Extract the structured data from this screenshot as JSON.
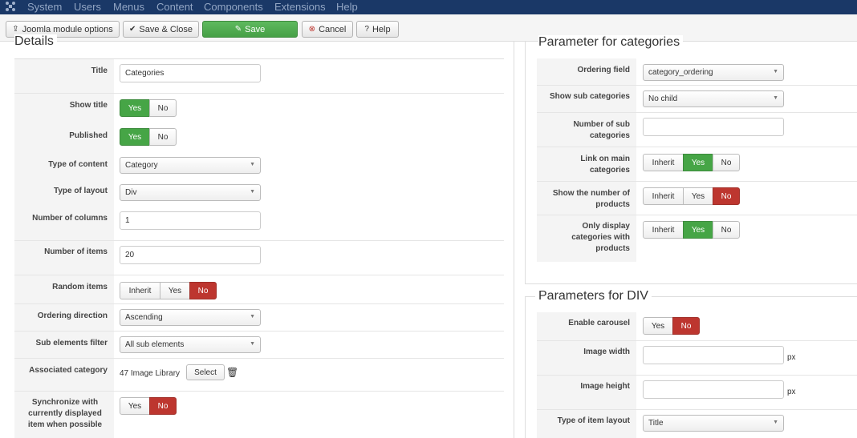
{
  "navbar": {
    "items": [
      "System",
      "Users",
      "Menus",
      "Content",
      "Components",
      "Extensions",
      "Help"
    ]
  },
  "toolbar": {
    "module_options": "Joomla module options",
    "save_close": "Save & Close",
    "save": "Save",
    "cancel": "Cancel",
    "help": "Help"
  },
  "details": {
    "legend": "Details",
    "title_label": "Title",
    "title_value": "Categories",
    "show_title_label": "Show title",
    "published_label": "Published",
    "type_content_label": "Type of content",
    "type_content_value": "Category",
    "type_layout_label": "Type of layout",
    "type_layout_value": "Div",
    "num_columns_label": "Number of columns",
    "num_columns_value": "1",
    "num_items_label": "Number of items",
    "num_items_value": "20",
    "random_items_label": "Random items",
    "ordering_direction_label": "Ordering direction",
    "ordering_direction_value": "Ascending",
    "sub_elements_label": "Sub elements filter",
    "sub_elements_value": "All sub elements",
    "associated_category_label": "Associated category",
    "associated_category_value": "47 Image Library",
    "select_label": "Select",
    "sync_label": "Synchronize with currently displayed item when possible"
  },
  "toggle": {
    "yes": "Yes",
    "no": "No",
    "inherit": "Inherit"
  },
  "categories": {
    "legend": "Parameter for categories",
    "ordering_field_label": "Ordering field",
    "ordering_field_value": "category_ordering",
    "show_sub_label": "Show sub categories",
    "show_sub_value": "No child",
    "num_sub_label": "Number of sub categories",
    "num_sub_value": "",
    "link_main_label": "Link on main categories",
    "show_number_label": "Show the number of products",
    "only_display_label": "Only display categories with products"
  },
  "div_params": {
    "legend": "Parameters for DIV",
    "enable_carousel_label": "Enable carousel",
    "image_width_label": "Image width",
    "image_height_label": "Image height",
    "px_unit": "px",
    "item_layout_label": "Type of item layout",
    "item_layout_value": "Title"
  },
  "colors": {
    "navbar": "#1a3867",
    "green": "#46a546",
    "red": "#bd362f"
  }
}
